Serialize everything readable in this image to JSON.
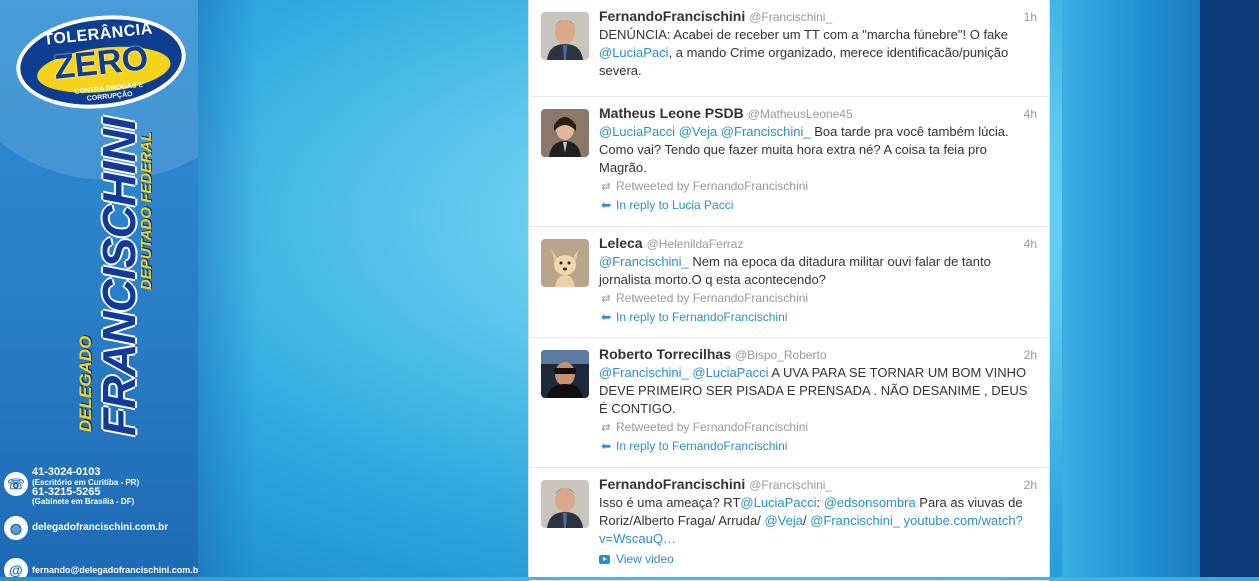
{
  "branding": {
    "logo_top": "TOLERÂNCIA",
    "logo_main": "ZERO",
    "logo_sub": "CONTRA DROGAS E CORRUPÇÃO",
    "delegado": "DELEGADO",
    "name": "FRANCISCHINI",
    "office": "DEPUTADO FEDERAL",
    "phone1": "41-3024-0103",
    "phone1_note": "(Escritório em Curitiba - PR)",
    "phone2": "61-3215-5265",
    "phone2_note": "(Gabinete em Brasília - DF)",
    "website": "delegadofrancischini.com.br",
    "email": "fernando@delegadofrancischini.com.br",
    "colors": {
      "navy": "#0b3a78",
      "brand_blue": "#123a9a",
      "yellow": "#f6d31b"
    }
  },
  "tweets": [
    {
      "name": "FernandoFrancischini",
      "handle": "@Francischini_",
      "time": "1h",
      "text_parts": [
        "DENÚNCIA: Acabei de receber um TT com a \"marcha fúnebre\"! O fake ",
        "@LuciaPaci",
        ", a mando Crime organizado, merece identificacão/punição severa."
      ]
    },
    {
      "name": "Matheus Leone PSDB",
      "handle": "@MatheusLeone45",
      "time": "4h",
      "text_parts": [
        "@LuciaPacci",
        " ",
        "@Veja",
        " ",
        "@Francischini_",
        " Boa tarde pra você também lúcia. Como vai? Tendo que fazer muita hora extra né? A coisa ta feia pro Magrão."
      ],
      "retweeted_by": "Retweeted by FernandoFrancischini",
      "reply_to": "In reply to Lucia Pacci"
    },
    {
      "name": "Leleca",
      "handle": "@HelenildaFerraz",
      "time": "4h",
      "text_parts": [
        "@Francischini_",
        " Nem na epoca da ditadura militar ouvi falar de tanto jornalista morto.O q esta acontecendo?"
      ],
      "retweeted_by": "Retweeted by FernandoFrancischini",
      "reply_to": "In reply to FernandoFrancischini"
    },
    {
      "name": "Roberto Torrecilhas",
      "handle": "@Bispo_Roberto",
      "time": "2h",
      "text_parts": [
        "@Francischini_",
        " ",
        "@LuciaPacci",
        " A UVA PARA SE TORNAR UM BOM VINHO DEVE PRIMEIRO SER PISADA E PRENSADA . NÃO DESANIME , DEUS É CONTIGO."
      ],
      "retweeted_by": "Retweeted by FernandoFrancischini",
      "reply_to": "In reply to FernandoFrancischini"
    },
    {
      "name": "FernandoFrancischini",
      "handle": "@Francischini_",
      "time": "2h",
      "text_parts": [
        "Isso é uma ameaça? RT",
        "@LuciaPacci",
        ": ",
        "@edsonsombra",
        " Para as viuvas de Roriz/Alberto Fraga/ Arruda/ ",
        "@Veja",
        "/ ",
        "@Francischini_",
        " ",
        "youtube.com/watch?v=WscauQ…"
      ],
      "view_video": "View video"
    }
  ]
}
